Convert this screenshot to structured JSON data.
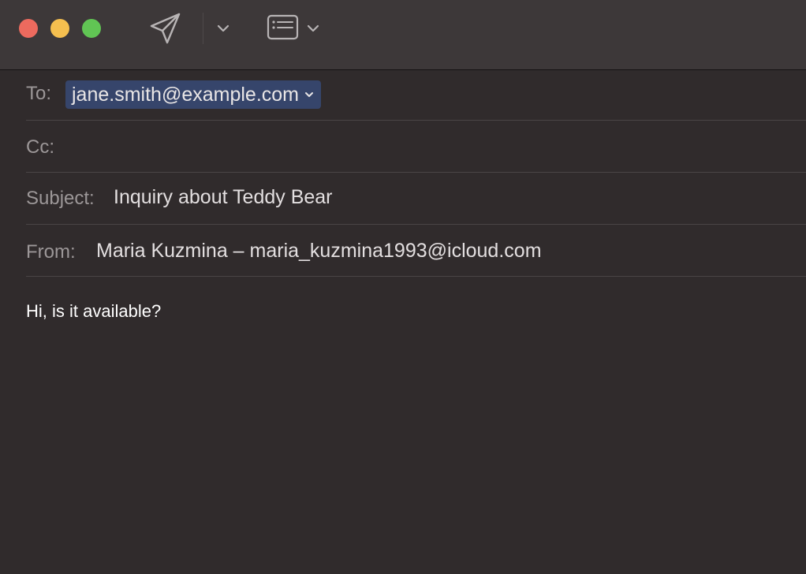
{
  "window": {
    "colors": {
      "background": "#302b2c",
      "toolbar": "#3d3839",
      "close": "#ed6a5e",
      "minimize": "#f5bf4f",
      "zoom": "#61c554",
      "token": "#36456b"
    }
  },
  "toolbar": {
    "send_icon": "paper-plane-icon",
    "send_options_icon": "chevron-down-icon",
    "format_icon": "header-fields-icon",
    "format_options_icon": "chevron-down-icon"
  },
  "header": {
    "to": {
      "label": "To:",
      "recipient": "jane.smith@example.com"
    },
    "cc": {
      "label": "Cc:",
      "value": ""
    },
    "subject": {
      "label": "Subject:",
      "value": "Inquiry about Teddy Bear"
    },
    "from": {
      "label": "From:",
      "value": "Maria Kuzmina – maria_kuzmina1993@icloud.com"
    }
  },
  "body": {
    "text": "Hi, is it available?"
  }
}
